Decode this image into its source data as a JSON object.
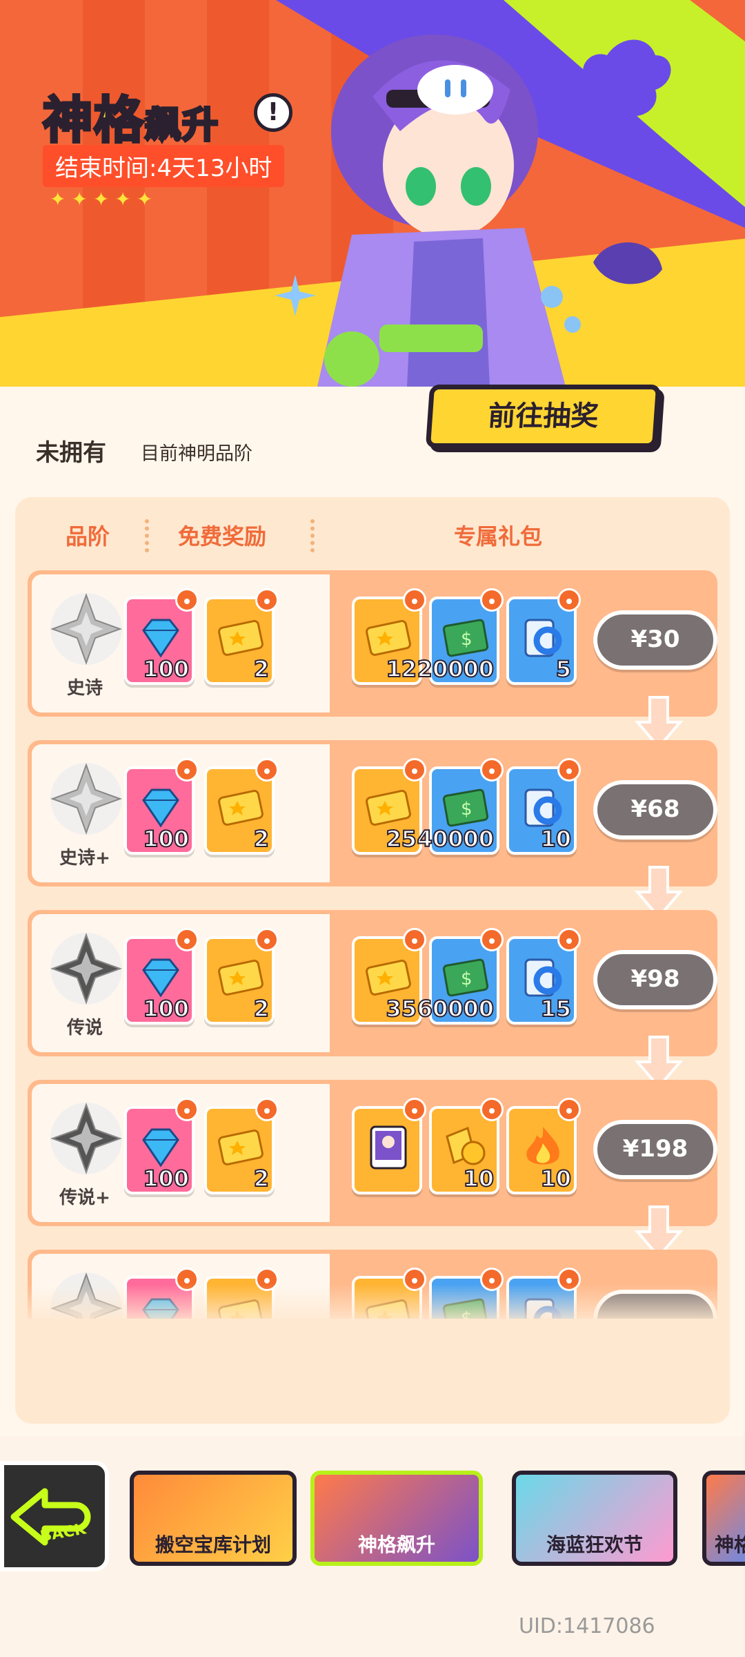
{
  "event": {
    "title_big": "神格",
    "title_small": "飙升",
    "help": "!",
    "end_time": "结束时间:4天13小时",
    "stars": "✦✦✦✦✦",
    "draw_button": "前往抽奖"
  },
  "status": {
    "label": "未拥有",
    "sub": "目前神明品阶"
  },
  "columns": {
    "rank": "品阶",
    "free": "免费奖励",
    "exclusive": "专属礼包"
  },
  "tiers": [
    {
      "rank": "史诗",
      "free": [
        "100",
        "2"
      ],
      "pack": [
        "12",
        "20000",
        "5"
      ],
      "price": "¥30"
    },
    {
      "rank": "史诗+",
      "free": [
        "100",
        "2"
      ],
      "pack": [
        "25",
        "40000",
        "10"
      ],
      "price": "¥68"
    },
    {
      "rank": "传说",
      "free": [
        "100",
        "2"
      ],
      "pack": [
        "35",
        "60000",
        "15"
      ],
      "price": "¥98"
    },
    {
      "rank": "传说+",
      "free": [
        "100",
        "2"
      ],
      "pack": [
        "",
        "10",
        "10"
      ],
      "price": "¥198"
    },
    {
      "rank": "",
      "free": [
        "",
        ""
      ],
      "pack": [
        "",
        "",
        ""
      ],
      "price": ""
    }
  ],
  "nav": {
    "back": "BACK",
    "tabs": [
      "搬空宝库计划",
      "神格飙升",
      "海蓝狂欢节",
      "神格"
    ]
  },
  "uid": "UID:1417086",
  "colors": {
    "banner": "#f3673a",
    "accent_yellow": "#ffd531",
    "panel": "#ffe8d0",
    "row": "#ffb98b",
    "price_button": "#7a7272",
    "lime": "#b8f01a"
  }
}
